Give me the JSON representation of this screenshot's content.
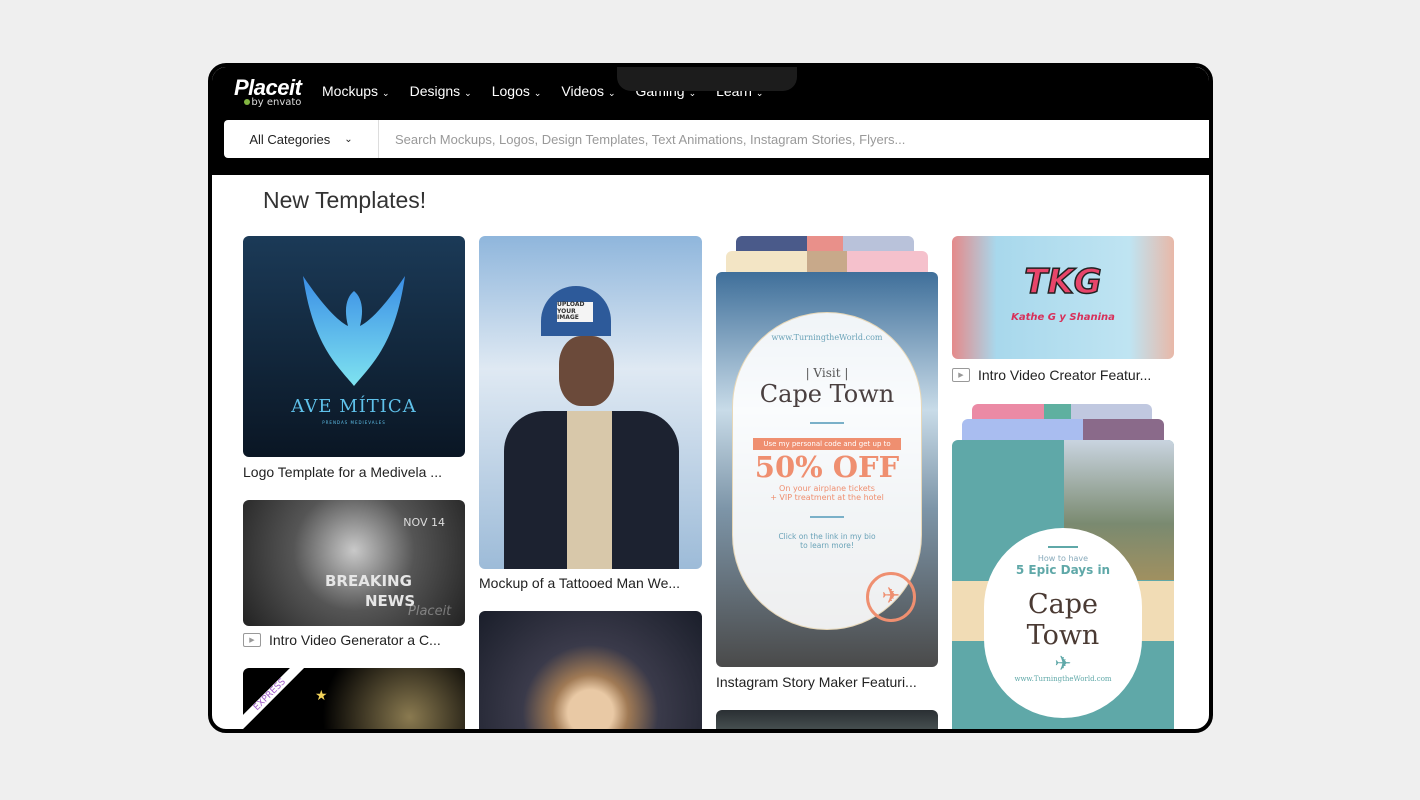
{
  "brand": {
    "name": "Placeit",
    "sub": "by envato"
  },
  "nav": [
    {
      "label": "Mockups"
    },
    {
      "label": "Designs"
    },
    {
      "label": "Logos"
    },
    {
      "label": "Videos"
    },
    {
      "label": "Gaming"
    },
    {
      "label": "Learn"
    }
  ],
  "search": {
    "category": "All Categories",
    "placeholder": "Search Mockups, Logos, Design Templates, Text Animations, Instagram Stories, Flyers..."
  },
  "section_title": "New Templates!",
  "cards": [
    {
      "caption": "Logo Template for a Medivela ...",
      "image_text": "AVE MÍTICA",
      "image_subtext": "PRENDAS MEDIEVALES"
    },
    {
      "caption": "Intro Video Generator a C...",
      "image_text": "BREAKING",
      "image_text2": "NEWS",
      "image_date": "NOV 14",
      "watermark": "Placeit",
      "icon": "play-icon"
    },
    {
      "badge": "EXPRESS"
    },
    {
      "caption": "Mockup of a Tattooed Man We...",
      "cap_text": "UPLOAD YOUR IMAGE"
    },
    {},
    {
      "caption": "Instagram Story Maker Featuri...",
      "url": "www.TurningtheWorld.com",
      "visit": "| Visit |",
      "city": "Cape Town",
      "promo": "Use my personal code and get up to",
      "offer": "50% OFF",
      "detail1": "On your airplane tickets",
      "detail2": "+ VIP treatment at the hotel",
      "cta1": "Click on the link in my bio",
      "cta2": "to learn more!"
    },
    {},
    {
      "caption": "Intro Video Creator Featur...",
      "image_text": "TKG",
      "image_subtext": "Kathe G y Shanina",
      "icon": "play-icon"
    },
    {
      "how": "How to have",
      "days": "5 Epic Days in",
      "city1": "Cape",
      "city2": "Town",
      "url": "www.TurningtheWorld.com"
    }
  ],
  "colors": {
    "header": "#000000",
    "accent_green": "#82b541",
    "promo": "#ef8f70",
    "teal": "#5fa8a8"
  }
}
